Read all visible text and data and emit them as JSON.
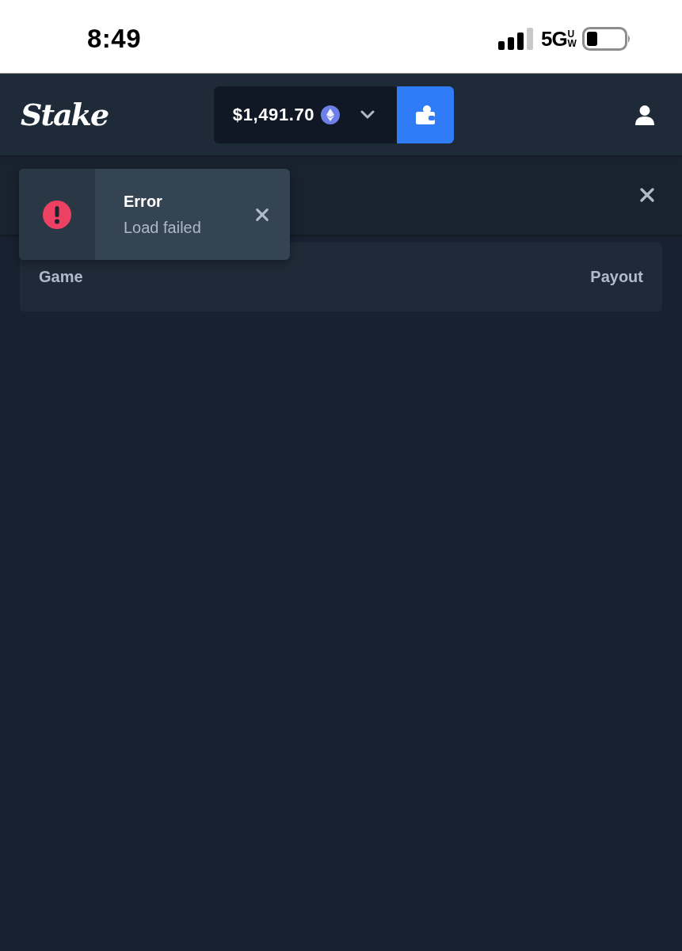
{
  "status_bar": {
    "time": "8:49",
    "network": "5G",
    "network_badge": "UW"
  },
  "header": {
    "logo": "Stake",
    "balance": "$1,491.70"
  },
  "modal": {
    "table": {
      "columns": [
        "Game",
        "Payout"
      ]
    }
  },
  "toast": {
    "kind": "error",
    "title": "Error",
    "message": "Load failed"
  }
}
